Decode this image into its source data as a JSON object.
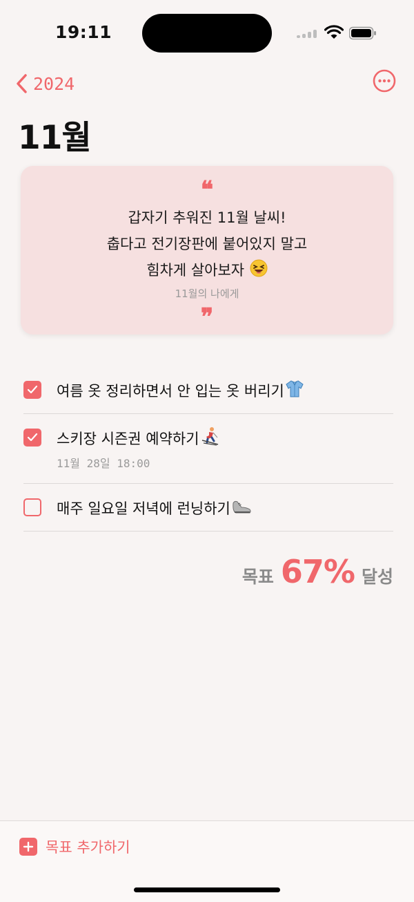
{
  "status": {
    "time": "19:11"
  },
  "nav": {
    "back_label": "2024"
  },
  "page_title": "11월",
  "quote": {
    "lines": [
      "갑자기 추워진 11월 날씨!",
      "춥다고 전기장판에 붙어있지 말고",
      "힘차게 살아보자"
    ],
    "caption": "11월의 나에게"
  },
  "goals": [
    {
      "text": "여름 옷 정리하면서 안 입는 옷 버리기",
      "checked": true,
      "icon": "shirt-icon"
    },
    {
      "text": "스키장 시즌권 예약하기",
      "checked": true,
      "icon": "skier-icon",
      "sub": "11월 28일 18:00"
    },
    {
      "text": "매주 일요일 저녁에 런닝하기",
      "checked": false,
      "icon": "sneaker-icon"
    }
  ],
  "summary": {
    "prefix": "목표",
    "percent": "67%",
    "suffix": "달성"
  },
  "bottom": {
    "add_label": "목표 추가하기"
  },
  "colors": {
    "accent": "#f0676b",
    "card": "#f6e0e0",
    "background": "#f8f4f3"
  }
}
